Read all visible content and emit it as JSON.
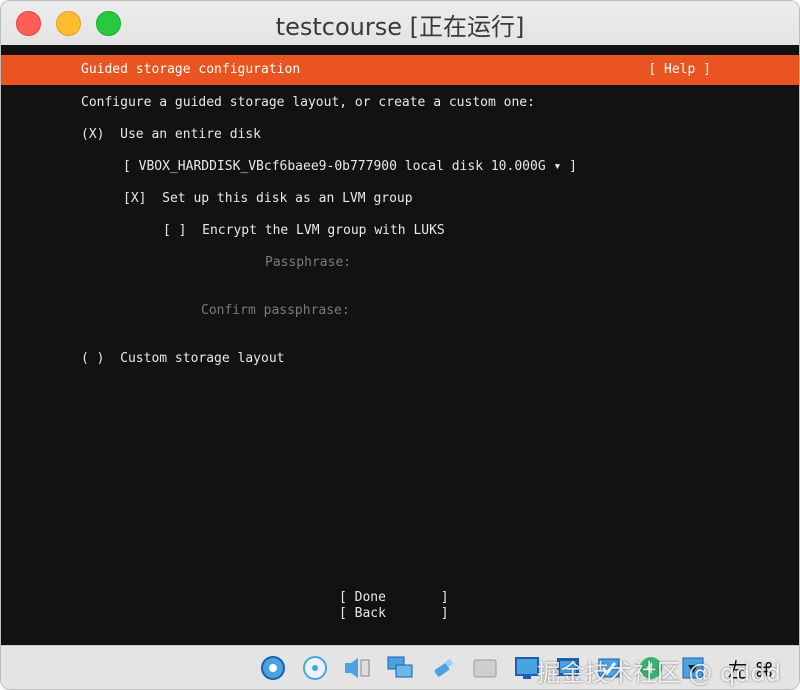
{
  "window": {
    "title": "testcourse [正在运行]"
  },
  "installer": {
    "header_title": "Guided storage configuration",
    "help_label": "[ Help ]",
    "intro": "Configure a guided storage layout, or create a custom one:",
    "option_entire_disk": "(X)  Use an entire disk",
    "disk_select": "[ VBOX_HARDDISK_VBcf6baee9-0b777900 local disk 10.000G ▾ ]",
    "lvm_checkbox": "[X]  Set up this disk as an LVM group",
    "luks_checkbox": "[ ]  Encrypt the LVM group with LUKS",
    "passphrase_label": "Passphrase:",
    "confirm_passphrase_label": "Confirm passphrase:",
    "option_custom": "( )  Custom storage layout",
    "done_button": "[ Done       ]",
    "back_button": "[ Back       ]"
  },
  "colors": {
    "accent": "#e95420",
    "screen_bg": "#121212",
    "text": "#e8e8e8",
    "dim_text": "#7a7a7a"
  },
  "dock": {
    "icons": [
      "hard-disk-icon",
      "optical-disk-icon",
      "audio-icon",
      "network-icon",
      "usb-icon",
      "shared-folder-icon",
      "display-icon",
      "screen-capture-icon",
      "video-capture-icon",
      "guest-additions-icon",
      "download-icon",
      "host-key-icon",
      "command-key-icon"
    ],
    "host_key_label": "左 ⌘"
  },
  "watermark": "掘金技术社区 @ qddd"
}
